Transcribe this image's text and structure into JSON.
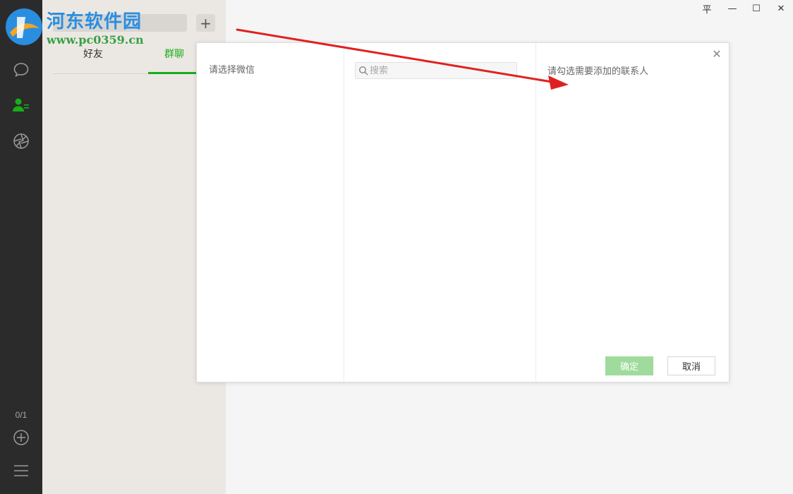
{
  "watermark": {
    "title": "河东软件园",
    "url": "www.pc0359.cn"
  },
  "sidebar": {
    "page_count": "0/1"
  },
  "contacts_panel": {
    "add_label": "+",
    "tabs": [
      {
        "label": "好友",
        "active": false
      },
      {
        "label": "群聊",
        "active": true
      }
    ]
  },
  "window_controls": {
    "pin": "平",
    "minimize": "—",
    "maximize": "☐",
    "close": "✕"
  },
  "dialog": {
    "left_title": "请选择微信",
    "search_placeholder": "搜索",
    "right_title": "请勾选需要添加的联系人",
    "close": "✕",
    "confirm_label": "确定",
    "cancel_label": "取消"
  },
  "colors": {
    "accent": "#1aad19",
    "confirm_disabled": "#9fdb9d",
    "annotation_arrow": "#e02020"
  }
}
